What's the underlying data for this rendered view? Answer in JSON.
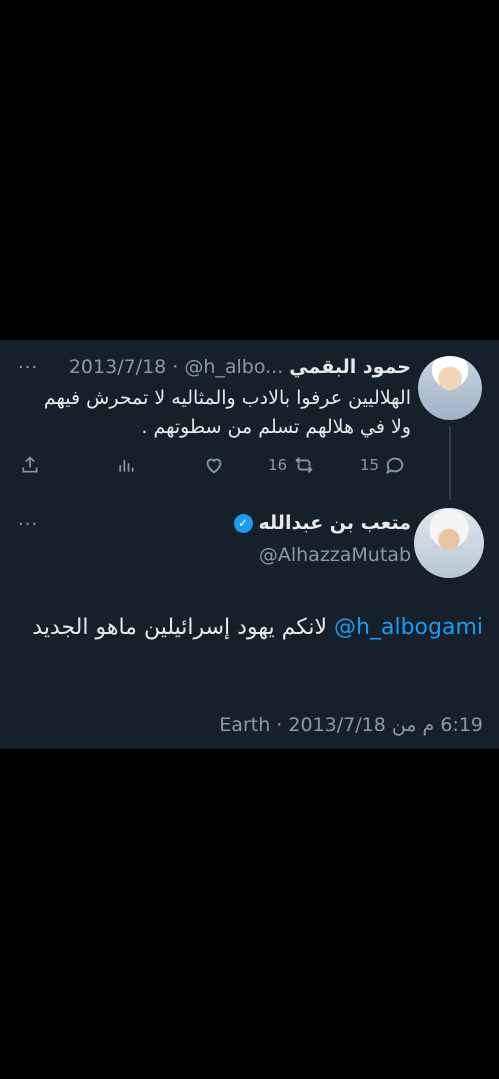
{
  "quoted_tweet": {
    "author_name": "حمود البقمي",
    "handle_truncated": "@h_albo...",
    "separator": "·",
    "date": "2013/7/18",
    "more_glyph": "···",
    "text": "الهلاليين عرفوا بالادب والمثاليه لا تمحرش فيهم ولا في هلالهم تسلم من سطوتهم .",
    "reply_count": "15",
    "retweet_count": "16"
  },
  "main_tweet": {
    "author_name": "متعب بن عبدالله",
    "verified_glyph": "✓",
    "handle": "@AlhazzaMutab",
    "more_glyph": "···",
    "mention": "@h_albogami",
    "text": "لانكم يهود  إسرائيلين ماهو الجديد",
    "meta": "6:19 م من Earth · 2013/7/18"
  },
  "colors": {
    "background": "#15202b",
    "text": "#e7e9ea",
    "muted": "#8b98a5",
    "accent": "#1d9bf0"
  }
}
